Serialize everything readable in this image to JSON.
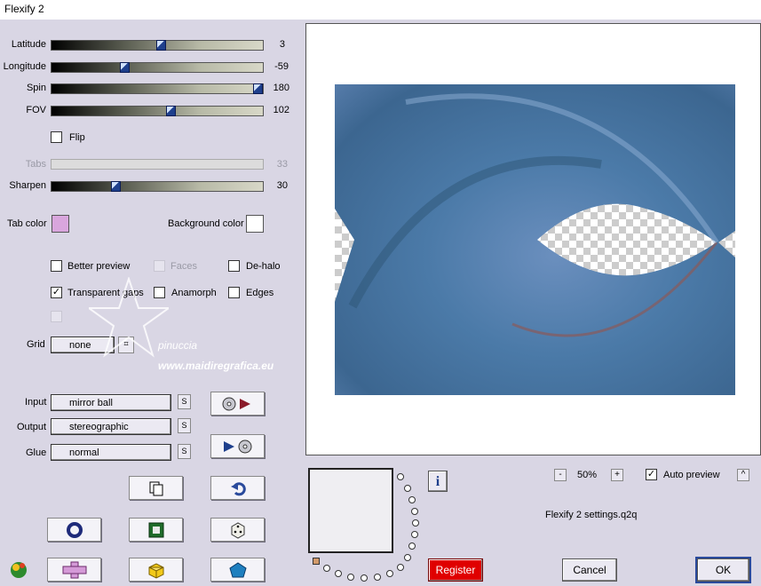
{
  "window": {
    "title": "Flexify 2"
  },
  "sliders": [
    {
      "label": "Latitude",
      "value": "3",
      "level": 0.52,
      "disabled": false
    },
    {
      "label": "Longitude",
      "value": "-59",
      "level": 0.34,
      "disabled": false
    },
    {
      "label": "Spin",
      "value": "180",
      "level": 1.0,
      "disabled": false
    },
    {
      "label": "FOV",
      "value": "102",
      "level": 0.56,
      "disabled": false
    },
    {
      "label": "Tabs",
      "value": "33",
      "level": 0.0,
      "disabled": true
    },
    {
      "label": "Sharpen",
      "value": "30",
      "level": 0.3,
      "disabled": false
    }
  ],
  "flip": {
    "label": "Flip",
    "checked": false
  },
  "colors": {
    "tab_color_label": "Tab color",
    "tab_color": "#d9a6dd",
    "background_color_label": "Background color",
    "background_color": "#ffffff"
  },
  "options": {
    "better_preview": {
      "label": "Better preview",
      "checked": false
    },
    "faces": {
      "label": "Faces",
      "checked": false
    },
    "de_halo": {
      "label": "De-halo",
      "checked": false
    },
    "transparent_gaps": {
      "label": "Transparent gaps",
      "checked": true
    },
    "anamorph": {
      "label": "Anamorph",
      "checked": false
    },
    "edges": {
      "label": "Edges",
      "checked": false
    }
  },
  "grid": {
    "label": "Grid",
    "value": "none"
  },
  "watermark": {
    "line1": "pinuccia",
    "line2": "www.maidiregrafica.eu"
  },
  "mapping": {
    "input_label": "Input",
    "input_value": "mirror ball",
    "output_label": "Output",
    "output_value": "stereographic",
    "glue_label": "Glue",
    "glue_value": "normal",
    "s_label": "S"
  },
  "preview": {
    "zoom_minus": "-",
    "zoom": "50%",
    "zoom_plus": "+",
    "auto_preview_label": "Auto preview",
    "auto_preview_checked": true,
    "collapse_label": "^",
    "settings_file": "Flexify 2 settings.q2q"
  },
  "buttons": {
    "register": "Register",
    "cancel": "Cancel",
    "ok": "OK",
    "info": "i"
  },
  "accent_colors": {
    "register_bg": "#e00000",
    "preview_blue": "#4b7aa8"
  }
}
